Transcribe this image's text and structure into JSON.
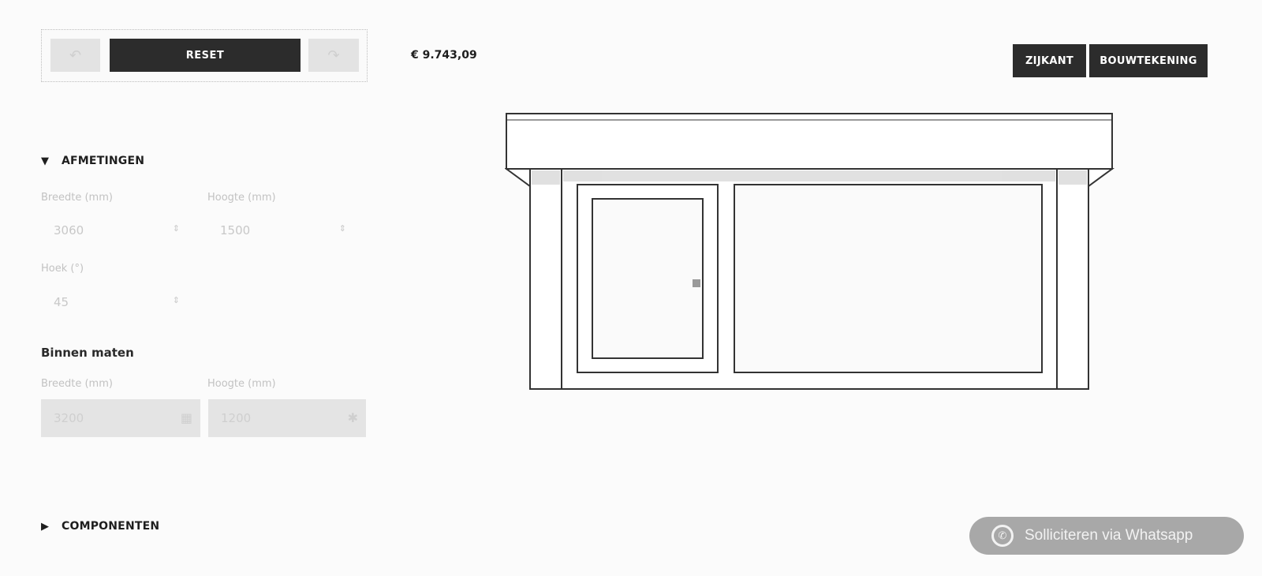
{
  "toolbar": {
    "undo_icon": "undo-icon",
    "reset_label": "RESET",
    "redo_icon": "redo-icon"
  },
  "price": "€ 9.743,09",
  "view_buttons": {
    "side": "ZIJKANT",
    "plan": "BOUWTEKENING"
  },
  "afmetingen": {
    "title": "AFMETINGEN",
    "breedte_label": "Breedte (mm)",
    "breedte_value": "3060",
    "hoogte_label": "Hoogte (mm)",
    "hoogte_value": "1500",
    "hoek_label": "Hoek (°)",
    "hoek_value": "45"
  },
  "binnen_maten": {
    "title": "Binnen maten",
    "breedte_label": "Breedte (mm)",
    "breedte_value": "3200",
    "hoogte_label": "Hoogte (mm)",
    "hoogte_value": "1200"
  },
  "componenten": {
    "title": "COMPONENTEN"
  },
  "whatsapp": {
    "label": "Solliciteren via Whatsapp",
    "icon": "whatsapp-icon"
  },
  "colors": {
    "dark_button": "#2c2c2c",
    "whatsapp_button": "#a8a8a8",
    "disabled_field": "#e4e4e4"
  }
}
